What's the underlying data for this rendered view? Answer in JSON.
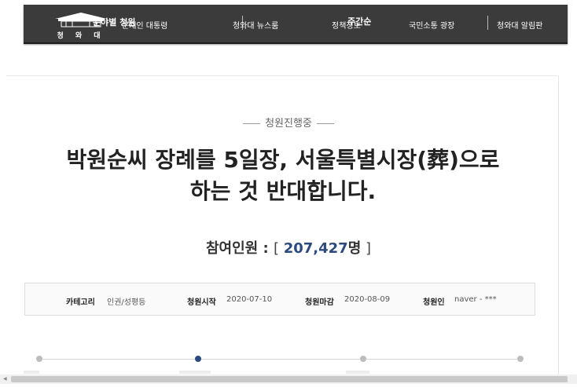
{
  "nav": {
    "logo_text": "청 와 대",
    "overlap_left": "분야별 청원",
    "overlap_right": "주간순",
    "items": [
      "문재인 대통령",
      "청와대 뉴스룸",
      "정책정보",
      "국민소통 광장",
      "청와대 알림판"
    ]
  },
  "petition": {
    "status": "청원진행중",
    "title_line1": "박원순씨 장례를 5일장, 서울특별시장(葬)으로",
    "title_line2": "하는 것 반대합니다.",
    "participants_label": "참여인원 : ",
    "participants_open": "[ ",
    "participants_count": "207,427",
    "participants_unit": "명",
    "participants_close": " ]"
  },
  "info": {
    "category_label": "카테고리",
    "category_value": "인권/성평등",
    "start_label": "청원시작",
    "start_value": "2020-07-10",
    "end_label": "청원마감",
    "end_value": "2020-08-09",
    "author_label": "청원인",
    "author_value": "naver - ***"
  },
  "colors": {
    "nav_bg": "#3b3b3b",
    "accent": "#2c4a7e"
  }
}
